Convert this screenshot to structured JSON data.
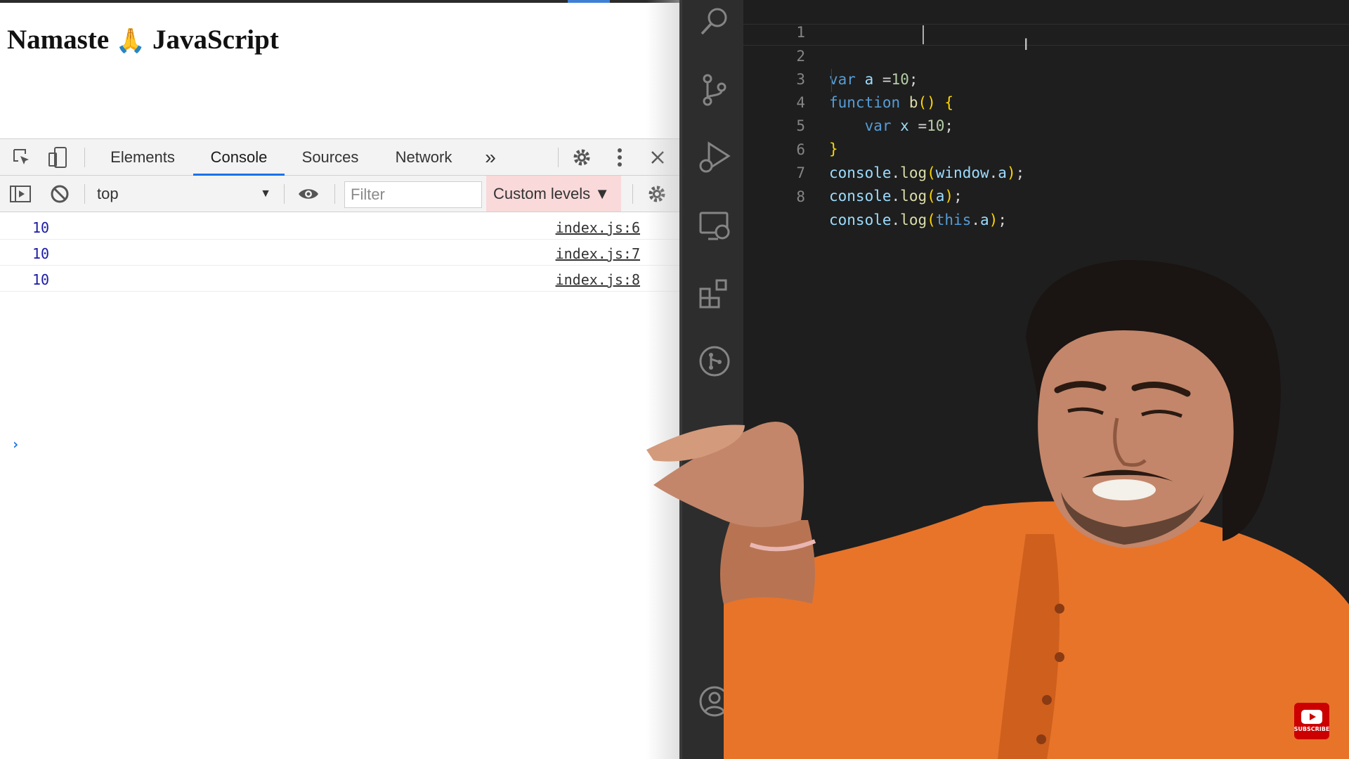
{
  "browser": {
    "page_title_prefix": "Namaste",
    "page_title_emoji": "🙏",
    "page_title_suffix": "JavaScript"
  },
  "devtools": {
    "tabs": [
      {
        "label": "Elements",
        "active": false
      },
      {
        "label": "Console",
        "active": true
      },
      {
        "label": "Sources",
        "active": false
      },
      {
        "label": "Network",
        "active": false
      }
    ],
    "more_tabs_label": "»",
    "toolbar": {
      "context": "top",
      "filter_placeholder": "Filter",
      "levels_label": "Custom levels ▼"
    },
    "console_messages": [
      {
        "value": "10",
        "source": "index.js:6"
      },
      {
        "value": "10",
        "source": "index.js:7"
      },
      {
        "value": "10",
        "source": "index.js:8"
      }
    ],
    "prompt_symbol": "›"
  },
  "editor": {
    "line_numbers": [
      "1",
      "2",
      "3",
      "4",
      "5",
      "6",
      "7",
      "8"
    ],
    "current_line": 2
  },
  "activity_bar": {
    "icons": [
      "search-icon",
      "source-control-icon",
      "run-debug-icon",
      "remote-explorer-icon",
      "extensions-icon",
      "git-graph-icon",
      "account-icon"
    ]
  },
  "youtube_badge": {
    "label": "SUBSCRIBE"
  },
  "colors": {
    "accent": "#1a73e8",
    "editor_bg": "#1e1e1e",
    "activity_bar_bg": "#2d2d2d",
    "levels_bg": "#f9d9d9",
    "shirt": "#e8742a"
  }
}
